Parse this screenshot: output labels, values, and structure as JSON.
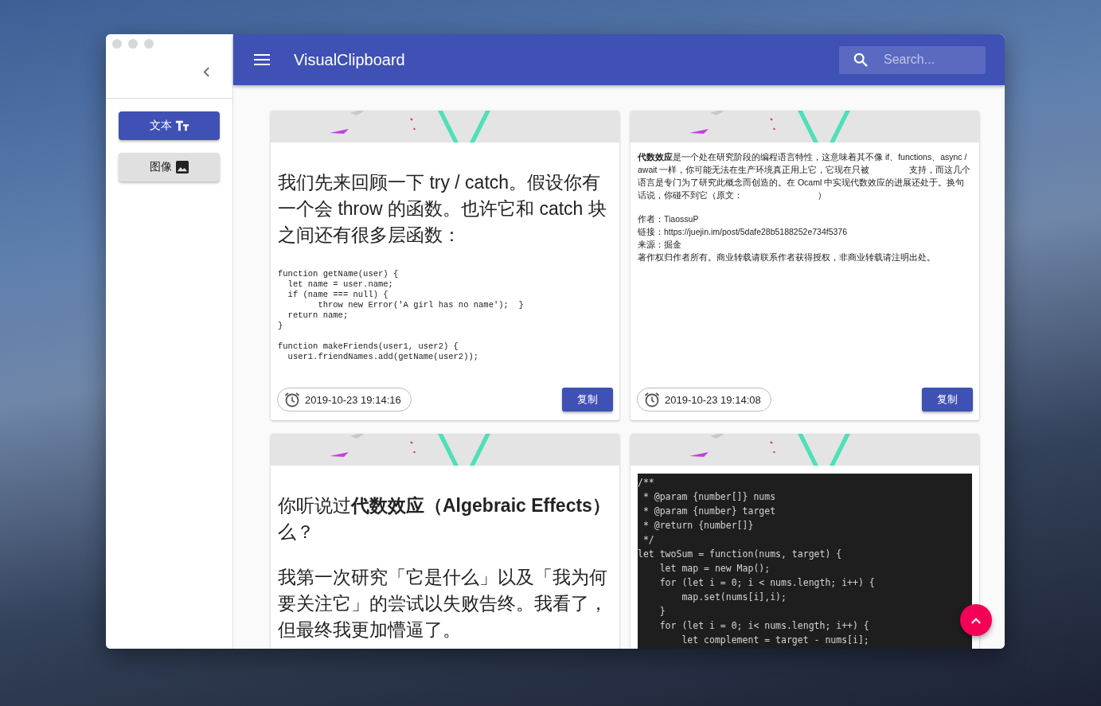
{
  "header": {
    "title": "VisualClipboard",
    "search": {
      "placeholder": "Search..."
    }
  },
  "sidebar": {
    "nav": [
      {
        "kind": "text",
        "label": "文本",
        "selected": true
      },
      {
        "kind": "image",
        "label": "图像",
        "selected": false
      }
    ]
  },
  "cards": [
    {
      "blocks": [
        {
          "kind": "heading",
          "text": "我们先来回顾一下 try / catch。假设你有一个会 throw 的函数。也许它和 catch 块之间还有很多层函数："
        },
        {
          "kind": "code",
          "lines": [
            "function getName(user) {",
            "  let name = user.name;",
            "  if (name === null) {",
            "        throw new Error('A girl has no name');  }",
            "  return name;",
            "}"
          ]
        },
        {
          "kind": "code",
          "lines": [
            "function makeFriends(user1, user2) {",
            "  user1.friendNames.add(getName(user2));"
          ]
        }
      ],
      "time": "2019-10-23 19:14:16",
      "copy_label": "复制"
    },
    {
      "blocks": [
        {
          "kind": "paragraph",
          "text": "**代数效应**是一个处在研究阶段的编程语言特性，这意味着其不像 if、functions、async / await 一样，你可能无法在生产环境真正用上它，它现在只被 　　　　 支持，而这几个语言是专门为了研究此概念而创造的。在 Ocaml 中实现代数效应的进展还处于。换句话说，你碰不到它（原文： 　　　　　　　　 ）"
        },
        {
          "kind": "lines",
          "lines": [
            "作者：TiaossuP",
            "链接：https://juejin.im/post/5dafe28b5188252e734f5376",
            "来源：掘金",
            "著作权归作者所有。商业转载请联系作者获得授权，非商业转载请注明出处。"
          ]
        }
      ],
      "time": "2019-10-23 19:14:08",
      "copy_label": "复制"
    },
    {
      "blocks": [
        {
          "kind": "heading",
          "text": "你听说过**代数效应（Algebraic Effects）**么？"
        },
        {
          "kind": "heading",
          "text": "我第一次研究「它是什么」以及「我为何要关注它」的尝试以失败告终。我看了，但最终我更加懵逼了。"
        }
      ]
    },
    {
      "blocks": [
        {
          "kind": "dark_code",
          "lines": [
            "/**",
            " * @param {number[]} nums",
            " * @param {number} target",
            " * @return {number[]}",
            " */",
            "let twoSum = function(nums, target) {",
            "    let map = new Map();",
            "    for (let i = 0; i < nums.length; i++) {",
            "        map.set(nums[i],i);",
            "    }",
            "    for (let i = 0; i< nums.length; i++) {",
            "        let complement = target - nums[i];"
          ]
        }
      ]
    }
  ]
}
